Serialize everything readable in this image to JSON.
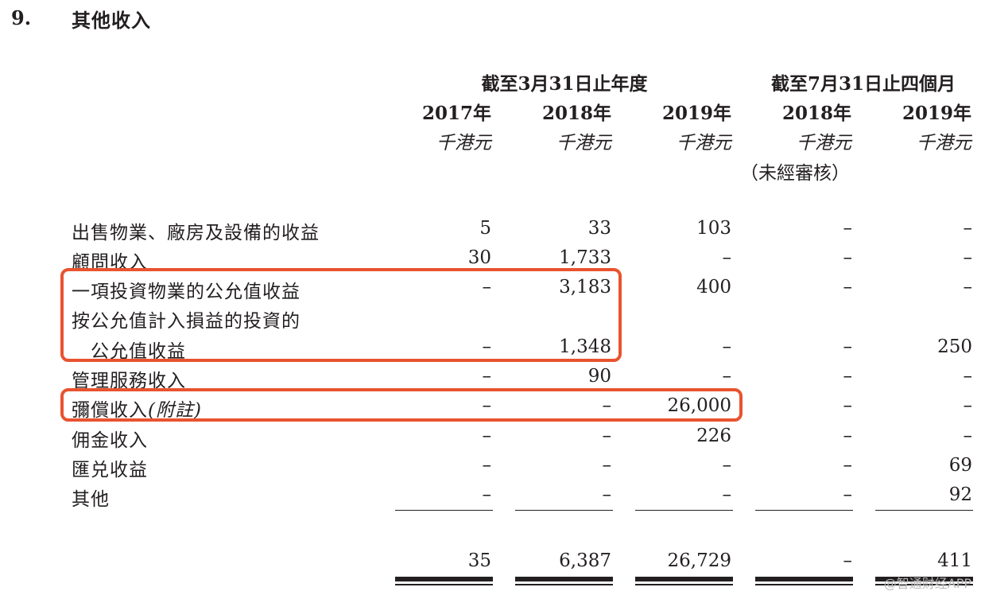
{
  "section": {
    "number": "9.",
    "title": "其他收入"
  },
  "header": {
    "group_1": "截至3月31日止年度",
    "group_2": "截至7月31日止四個月",
    "years": [
      "2017年",
      "2018年",
      "2019年",
      "2018年",
      "2019年"
    ],
    "unit": "千港元",
    "unaudited_note": "（未經審核）"
  },
  "rows": [
    {
      "label": "出售物業、廠房及設備的收益",
      "values": [
        "5",
        "33",
        "103",
        "–",
        "–"
      ]
    },
    {
      "label": "顧問收入",
      "values": [
        "30",
        "1,733",
        "–",
        "–",
        "–"
      ]
    },
    {
      "label": "一項投資物業的公允值收益",
      "values": [
        "–",
        "3,183",
        "400",
        "–",
        "–"
      ]
    },
    {
      "label": "按公允值計入損益的投資的",
      "values": [
        "",
        "",
        "",
        "",
        ""
      ]
    },
    {
      "label": "公允值收益",
      "values": [
        "–",
        "1,348",
        "–",
        "–",
        "250"
      ]
    },
    {
      "label": "管理服務收入",
      "values": [
        "–",
        "90",
        "–",
        "–",
        "–"
      ]
    },
    {
      "label": "彌償收入",
      "note": "(附註)",
      "values": [
        "–",
        "–",
        "26,000",
        "–",
        "–"
      ]
    },
    {
      "label": "佣金收入",
      "values": [
        "–",
        "–",
        "226",
        "–",
        "–"
      ]
    },
    {
      "label": "匯兑收益",
      "values": [
        "–",
        "–",
        "–",
        "–",
        "69"
      ]
    },
    {
      "label": "其他",
      "values": [
        "–",
        "–",
        "–",
        "–",
        "92"
      ]
    }
  ],
  "totals": [
    "35",
    "6,387",
    "26,729",
    "–",
    "411"
  ],
  "watermark": "@智通财经APP",
  "highlight_color": "#e8532f"
}
